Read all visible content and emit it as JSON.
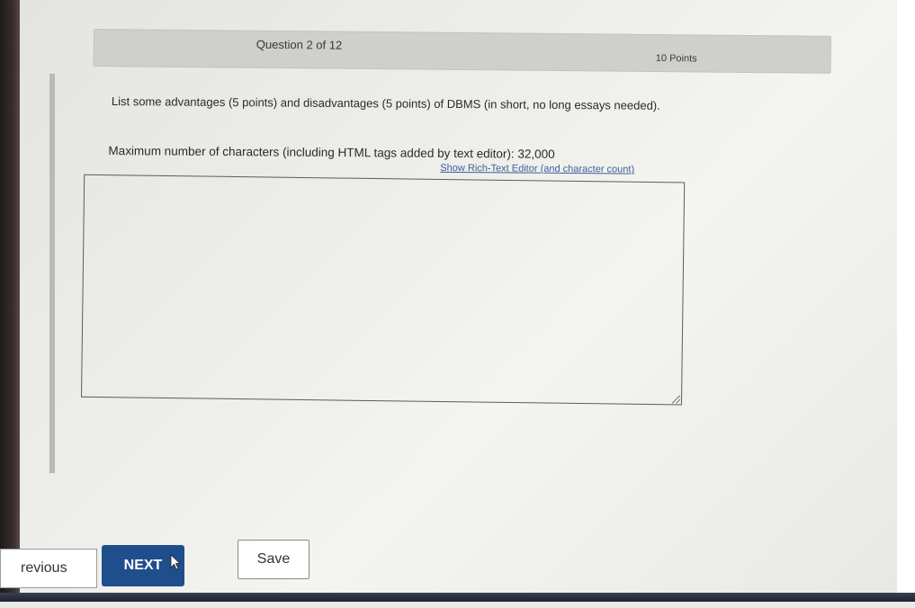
{
  "header": {
    "question_number": "Question 2 of 12",
    "points": "10 Points"
  },
  "question": {
    "text": "List some advantages (5 points) and disadvantages (5 points) of DBMS (in short, no long essays needed).",
    "max_chars_note": "Maximum number of characters (including HTML tags added by text editor): 32,000",
    "rich_text_link": "Show Rich-Text Editor (and character count)"
  },
  "answer": {
    "value": ""
  },
  "navigation": {
    "previous_label": "revious",
    "next_label": "NEXT",
    "save_label": "Save"
  },
  "colors": {
    "next_button": "#1f4e8c",
    "link": "#3a5f9a",
    "header_bar": "#cfcfcb"
  }
}
